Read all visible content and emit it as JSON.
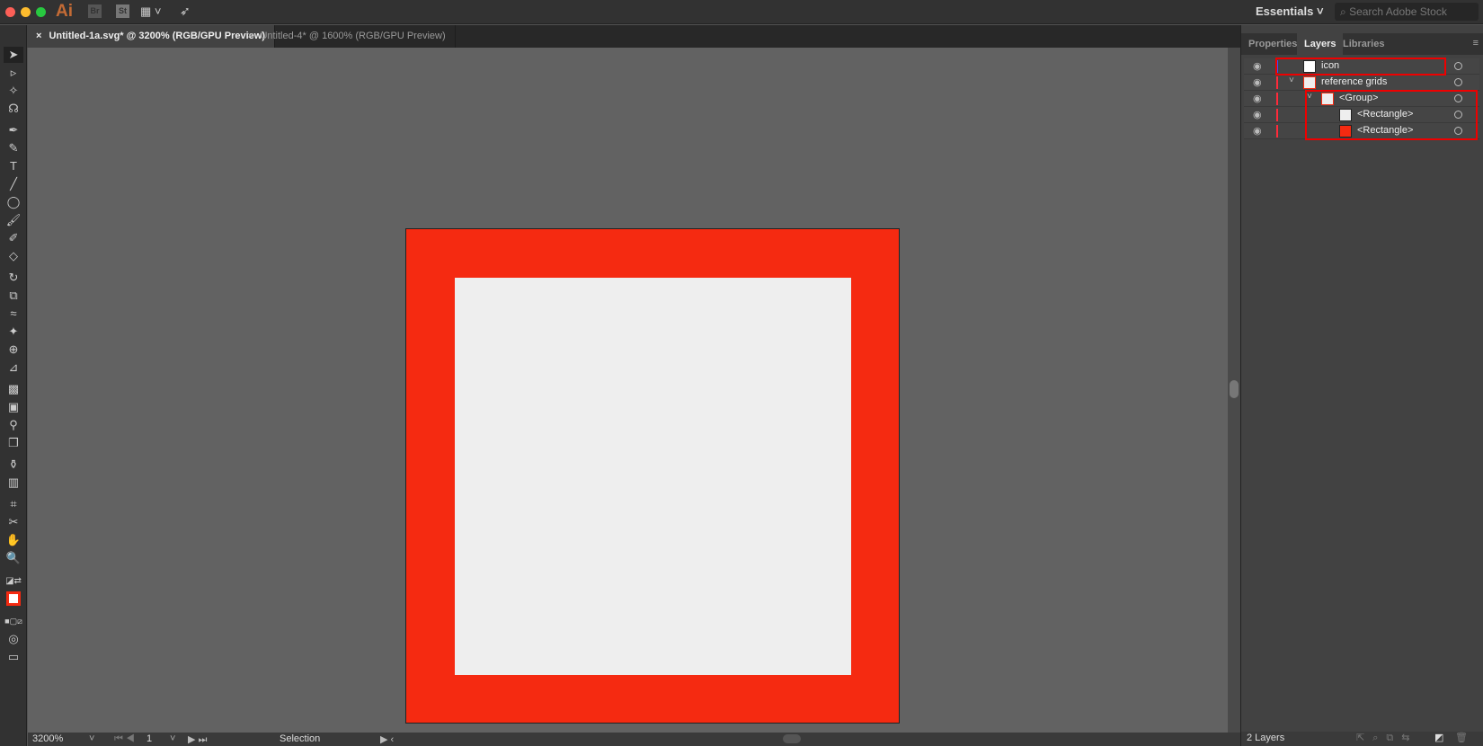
{
  "app": {
    "logo": "Ai",
    "bridge": "Br",
    "stock": "St",
    "workspace": "Essentials",
    "search_placeholder": "Search Adobe Stock"
  },
  "tabs": [
    {
      "label": "Untitled-1a.svg* @ 3200% (RGB/GPU Preview)",
      "active": true
    },
    {
      "label": "Untitled-4* @ 1600% (RGB/GPU Preview)",
      "active": false
    }
  ],
  "artwork": {
    "outer_color": "#f52a11",
    "inner_color": "#eeeeee"
  },
  "status": {
    "zoom": "3200%",
    "artboard": "1",
    "tool": "Selection"
  },
  "panel": {
    "tabs": [
      "Properties",
      "Layers",
      "Libraries"
    ],
    "active_tab": "Layers",
    "layers": [
      {
        "name": "icon",
        "depth": 0,
        "swatch": "#ffffff",
        "color": "#3355ff",
        "expanded": null
      },
      {
        "name": "reference grids",
        "depth": 0,
        "swatch": "#eeeeee",
        "color": "#ff2a3a",
        "expanded": true
      },
      {
        "name": "<Group>",
        "depth": 1,
        "swatch": "#eeeeee",
        "color": "#ff2a3a",
        "expanded": true
      },
      {
        "name": "<Rectangle>",
        "depth": 2,
        "swatch": "#eeeeee",
        "color": "#ff2a3a",
        "expanded": null
      },
      {
        "name": "<Rectangle>",
        "depth": 2,
        "swatch": "#f52a11",
        "color": "#ff2a3a",
        "expanded": null
      }
    ],
    "footer": "2 Layers"
  }
}
